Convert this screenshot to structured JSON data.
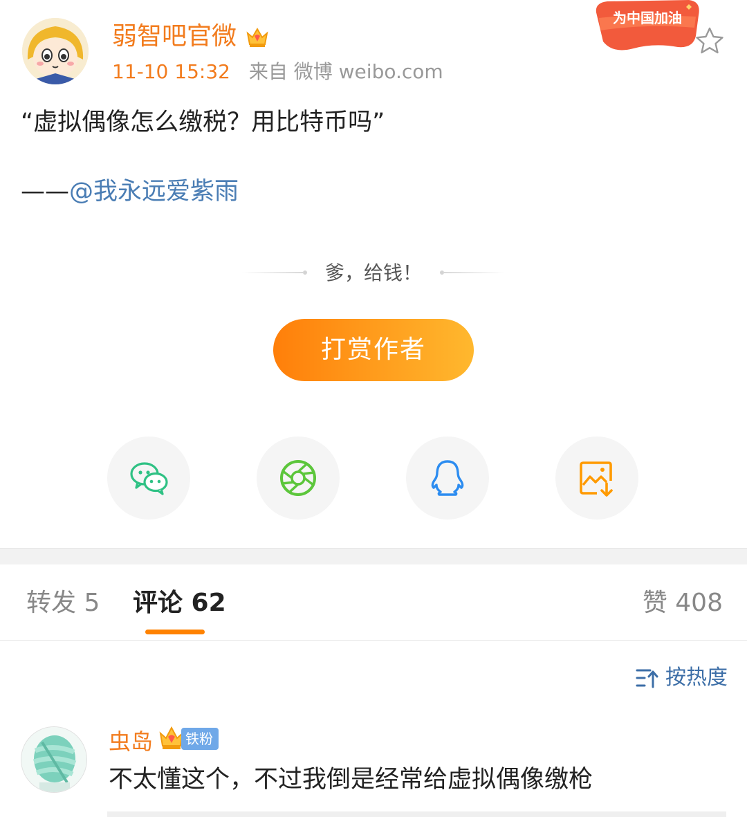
{
  "post": {
    "author": "弱智吧官微",
    "time": "11-10 15:32",
    "source": "来自 微博 weibo.com",
    "campaign_badge": "为中国加油",
    "body_line1": "“虚拟偶像怎么缴税？用比特币吗”",
    "credit_prefix": "——",
    "mention": "@我永远爱紫雨"
  },
  "reward": {
    "slogan": "爹，给钱！",
    "button_label": "打赏作者"
  },
  "share": {
    "wechat_color": "#2fc184",
    "moments_color": "#5cc63b",
    "qq_color": "#2c8cf0",
    "save_image_color": "#ff9a00"
  },
  "tabs": {
    "repost": "转发 5",
    "comments": "评论 62",
    "likes": "赞 408"
  },
  "sort": {
    "label": "按热度"
  },
  "comments": [
    {
      "user": "虫岛",
      "fan_badge": "铁粉",
      "text": "不太懂这个，不过我倒是经常给虚拟偶像缴枪"
    }
  ],
  "colors": {
    "accent": "#ff8200",
    "username": "#f27c1e",
    "link": "#4a7db4"
  }
}
